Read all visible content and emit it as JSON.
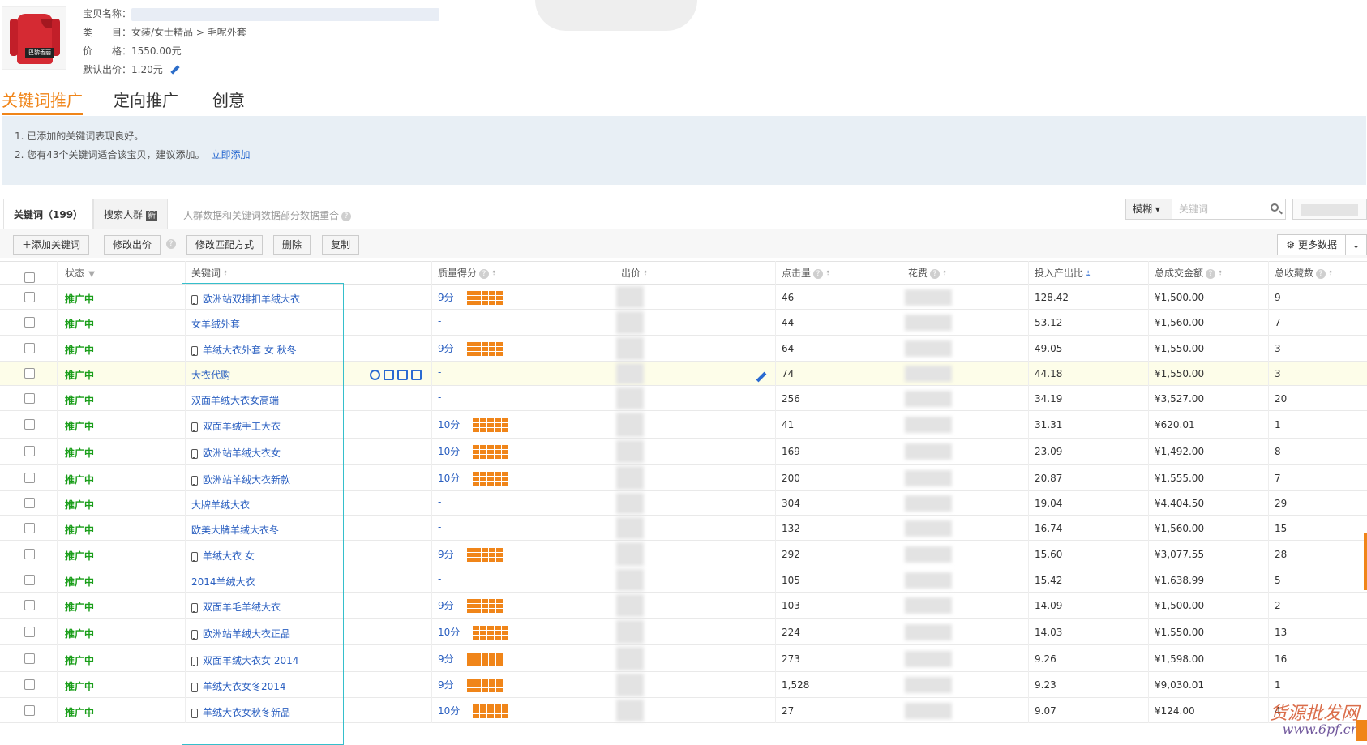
{
  "product": {
    "name_label": "宝贝名称：",
    "category_label": "类　　目：",
    "category_value": "女装/女士精品 > 毛呢外套",
    "price_label": "价　　格：",
    "price_value": "1550.00元",
    "default_bid_label": "默认出价：",
    "default_bid_value": "1.20元",
    "thumb_tag": "巴黎香丽"
  },
  "main_tabs": [
    "关键词推广",
    "定向推广",
    "创意"
  ],
  "notice": {
    "line1": "1. 已添加的关键词表现良好。",
    "line2": "2. 您有43个关键词适合该宝贝，建议添加。",
    "link": "立即添加"
  },
  "sub_tabs": {
    "keywords": "关键词（199）",
    "crowd": "搜索人群",
    "crowd_badge": "新",
    "hint": "人群数据和关键词数据部分数据重合"
  },
  "search": {
    "mode": "模糊",
    "placeholder": "关键词"
  },
  "toolbar": {
    "add": "添加关键词",
    "edit_bid": "修改出价",
    "edit_match": "修改匹配方式",
    "delete": "删除",
    "copy": "复制",
    "more": "更多数据"
  },
  "columns": [
    "状态",
    "关键词",
    "质量得分",
    "出价",
    "点击量",
    "花费",
    "投入产出比",
    "总成交金额",
    "总收藏数"
  ],
  "rows": [
    {
      "status": "推广中",
      "kw": "欧洲站双排扣羊绒大衣",
      "mobile": true,
      "q": "9分",
      "clicks": "46",
      "roi": "128.42",
      "amount": "¥1,500.00",
      "fav": "9"
    },
    {
      "status": "推广中",
      "kw": "女羊绒外套",
      "mobile": false,
      "q": "-",
      "clicks": "44",
      "roi": "53.12",
      "amount": "¥1,560.00",
      "fav": "7"
    },
    {
      "status": "推广中",
      "kw": "羊绒大衣外套 女 秋冬",
      "mobile": true,
      "q": "9分",
      "clicks": "64",
      "roi": "49.05",
      "amount": "¥1,550.00",
      "fav": "3"
    },
    {
      "status": "推广中",
      "kw": "大衣代购",
      "mobile": false,
      "q": "-",
      "clicks": "74",
      "roi": "44.18",
      "amount": "¥1,550.00",
      "fav": "3"
    },
    {
      "status": "推广中",
      "kw": "双面羊绒大衣女高端",
      "mobile": false,
      "q": "-",
      "clicks": "256",
      "roi": "34.19",
      "amount": "¥3,527.00",
      "fav": "20"
    },
    {
      "status": "推广中",
      "kw": "双面羊绒手工大衣",
      "mobile": true,
      "q": "10分",
      "clicks": "41",
      "roi": "31.31",
      "amount": "¥620.01",
      "fav": "1"
    },
    {
      "status": "推广中",
      "kw": "欧洲站羊绒大衣女",
      "mobile": true,
      "q": "10分",
      "clicks": "169",
      "roi": "23.09",
      "amount": "¥1,492.00",
      "fav": "8"
    },
    {
      "status": "推广中",
      "kw": "欧洲站羊绒大衣新款",
      "mobile": true,
      "q": "10分",
      "clicks": "200",
      "roi": "20.87",
      "amount": "¥1,555.00",
      "fav": "7"
    },
    {
      "status": "推广中",
      "kw": "大牌羊绒大衣",
      "mobile": false,
      "q": "-",
      "clicks": "304",
      "roi": "19.04",
      "amount": "¥4,404.50",
      "fav": "29"
    },
    {
      "status": "推广中",
      "kw": "欧美大牌羊绒大衣冬",
      "mobile": false,
      "q": "-",
      "clicks": "132",
      "roi": "16.74",
      "amount": "¥1,560.00",
      "fav": "15"
    },
    {
      "status": "推广中",
      "kw": "羊绒大衣 女",
      "mobile": true,
      "q": "9分",
      "clicks": "292",
      "roi": "15.60",
      "amount": "¥3,077.55",
      "fav": "28"
    },
    {
      "status": "推广中",
      "kw": "2014羊绒大衣",
      "mobile": false,
      "q": "-",
      "clicks": "105",
      "roi": "15.42",
      "amount": "¥1,638.99",
      "fav": "5"
    },
    {
      "status": "推广中",
      "kw": "双面羊毛羊绒大衣",
      "mobile": true,
      "q": "9分",
      "clicks": "103",
      "roi": "14.09",
      "amount": "¥1,500.00",
      "fav": "2"
    },
    {
      "status": "推广中",
      "kw": "欧洲站羊绒大衣正品",
      "mobile": true,
      "q": "10分",
      "clicks": "224",
      "roi": "14.03",
      "amount": "¥1,550.00",
      "fav": "13"
    },
    {
      "status": "推广中",
      "kw": "双面羊绒大衣女 2014",
      "mobile": true,
      "q": "9分",
      "clicks": "273",
      "roi": "9.26",
      "amount": "¥1,598.00",
      "fav": "16"
    },
    {
      "status": "推广中",
      "kw": "羊绒大衣女冬2014",
      "mobile": true,
      "q": "9分",
      "clicks": "1,528",
      "roi": "9.23",
      "amount": "¥9,030.01",
      "fav": "1"
    },
    {
      "status": "推广中",
      "kw": "羊绒大衣女秋冬新品",
      "mobile": true,
      "q": "10分",
      "clicks": "27",
      "roi": "9.07",
      "amount": "¥124.00",
      "fav": "4"
    }
  ],
  "watermark": {
    "line1": "货源批发网",
    "line2": "www.6pf.cn"
  },
  "colors": {
    "accent": "#f08519",
    "link": "#2a6ad1",
    "status": "#1a9e1a",
    "highlight_box": "#35bfcc"
  }
}
